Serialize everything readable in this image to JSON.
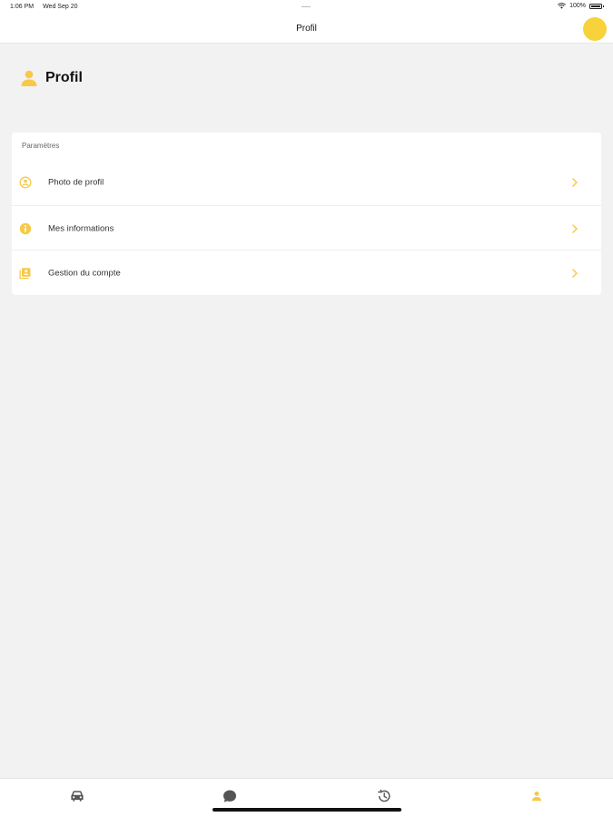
{
  "status_bar": {
    "time": "1:06 PM",
    "date": "Wed Sep 20",
    "battery": "100%"
  },
  "nav": {
    "title": "Profil"
  },
  "header": {
    "title": "Profil",
    "icon": "person-icon"
  },
  "settings": {
    "section_label": "Paramètres",
    "items": [
      {
        "label": "Photo de profil",
        "icon": "profile-photo-icon"
      },
      {
        "label": "Mes informations",
        "icon": "info-icon"
      },
      {
        "label": "Gestion du compte",
        "icon": "account-management-icon"
      }
    ]
  },
  "tab_bar": {
    "tabs": [
      {
        "name": "car",
        "icon": "car-icon",
        "active": false
      },
      {
        "name": "chat",
        "icon": "chat-bubble-icon",
        "active": false
      },
      {
        "name": "history",
        "icon": "history-icon",
        "active": false
      },
      {
        "name": "profile",
        "icon": "person-icon",
        "active": true
      }
    ]
  },
  "colors": {
    "accent": "#f7c948",
    "background": "#f2f2f2",
    "card": "#ffffff",
    "inactive_icon": "#555555"
  }
}
